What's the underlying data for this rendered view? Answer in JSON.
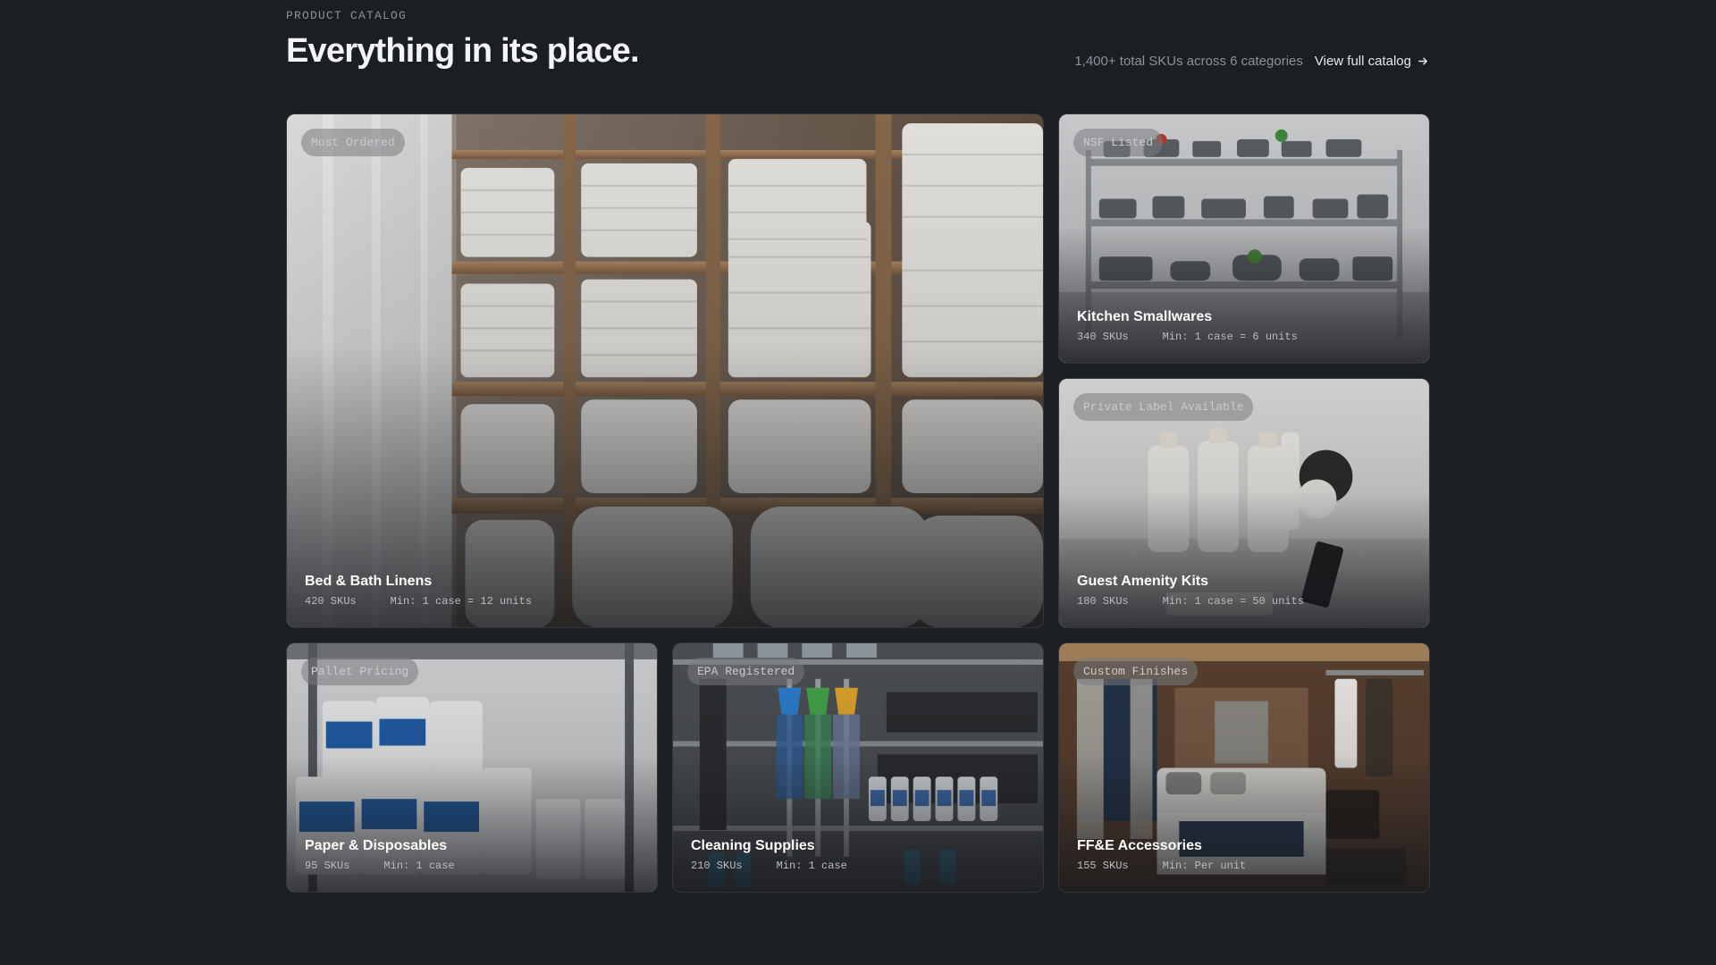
{
  "header": {
    "eyebrow": "PRODUCT CATALOG",
    "title": "Everything in its place.",
    "total": "1,400+ total SKUs across 6 categories",
    "view_link": "View full catalog"
  },
  "categories": [
    {
      "badge": "Most Ordered",
      "title": "Bed & Bath Linens",
      "skus": "420 SKUs",
      "min": "Min: 1 case = 12 units"
    },
    {
      "badge": "NSF Listed",
      "title": "Kitchen Smallwares",
      "skus": "340 SKUs",
      "min": "Min: 1 case = 6 units"
    },
    {
      "badge": "Private Label Available",
      "title": "Guest Amenity Kits",
      "skus": "180 SKUs",
      "min": "Min: 1 case = 50 units"
    },
    {
      "badge": "Pallet Pricing",
      "title": "Paper & Disposables",
      "skus": "95 SKUs",
      "min": "Min: 1 case"
    },
    {
      "badge": "EPA Registered",
      "title": "Cleaning Supplies",
      "skus": "210 SKUs",
      "min": "Min: 1 case"
    },
    {
      "badge": "Custom Finishes",
      "title": "FF&E Accessories",
      "skus": "155 SKUs",
      "min": "Min: Per unit"
    }
  ]
}
